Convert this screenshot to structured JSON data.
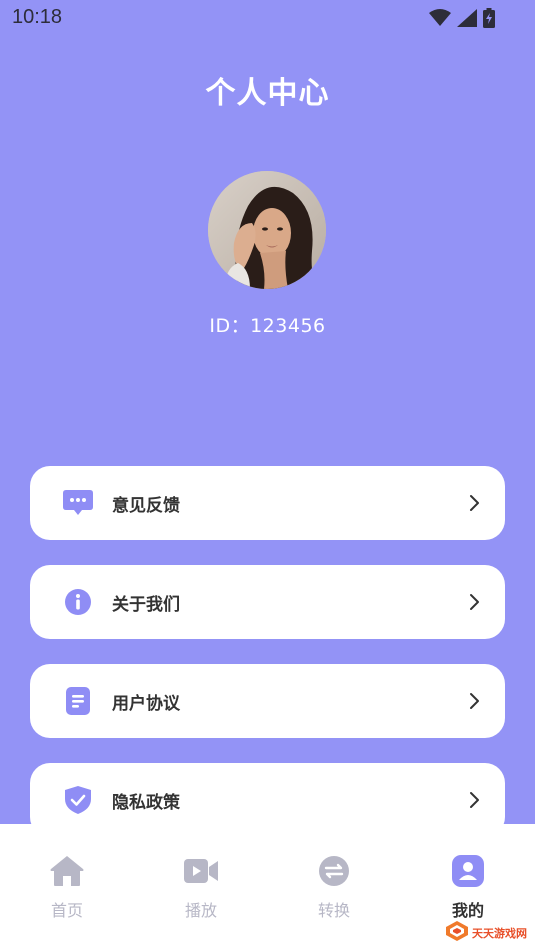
{
  "status_bar": {
    "time": "10:18",
    "icons": [
      "wifi-icon",
      "signal-icon",
      "battery-icon"
    ]
  },
  "header": {
    "title": "个人中心"
  },
  "profile": {
    "id_text": "ID：123456"
  },
  "menu": {
    "items": [
      {
        "label": "意见反馈",
        "icon": "feedback-icon"
      },
      {
        "label": "关于我们",
        "icon": "info-icon"
      },
      {
        "label": "用户协议",
        "icon": "document-icon"
      },
      {
        "label": "隐私政策",
        "icon": "shield-check-icon"
      }
    ]
  },
  "tab_bar": {
    "tabs": [
      {
        "label": "首页",
        "icon": "home-icon",
        "active": false
      },
      {
        "label": "播放",
        "icon": "video-icon",
        "active": false
      },
      {
        "label": "转换",
        "icon": "convert-icon",
        "active": false
      },
      {
        "label": "我的",
        "icon": "user-icon",
        "active": true
      }
    ]
  },
  "watermark": {
    "text": "天天游戏网"
  },
  "colors": {
    "background": "#9393F6",
    "accent": "#8F8DF5",
    "card": "#FFFFFF",
    "inactive_tab": "#B7B7C6"
  }
}
